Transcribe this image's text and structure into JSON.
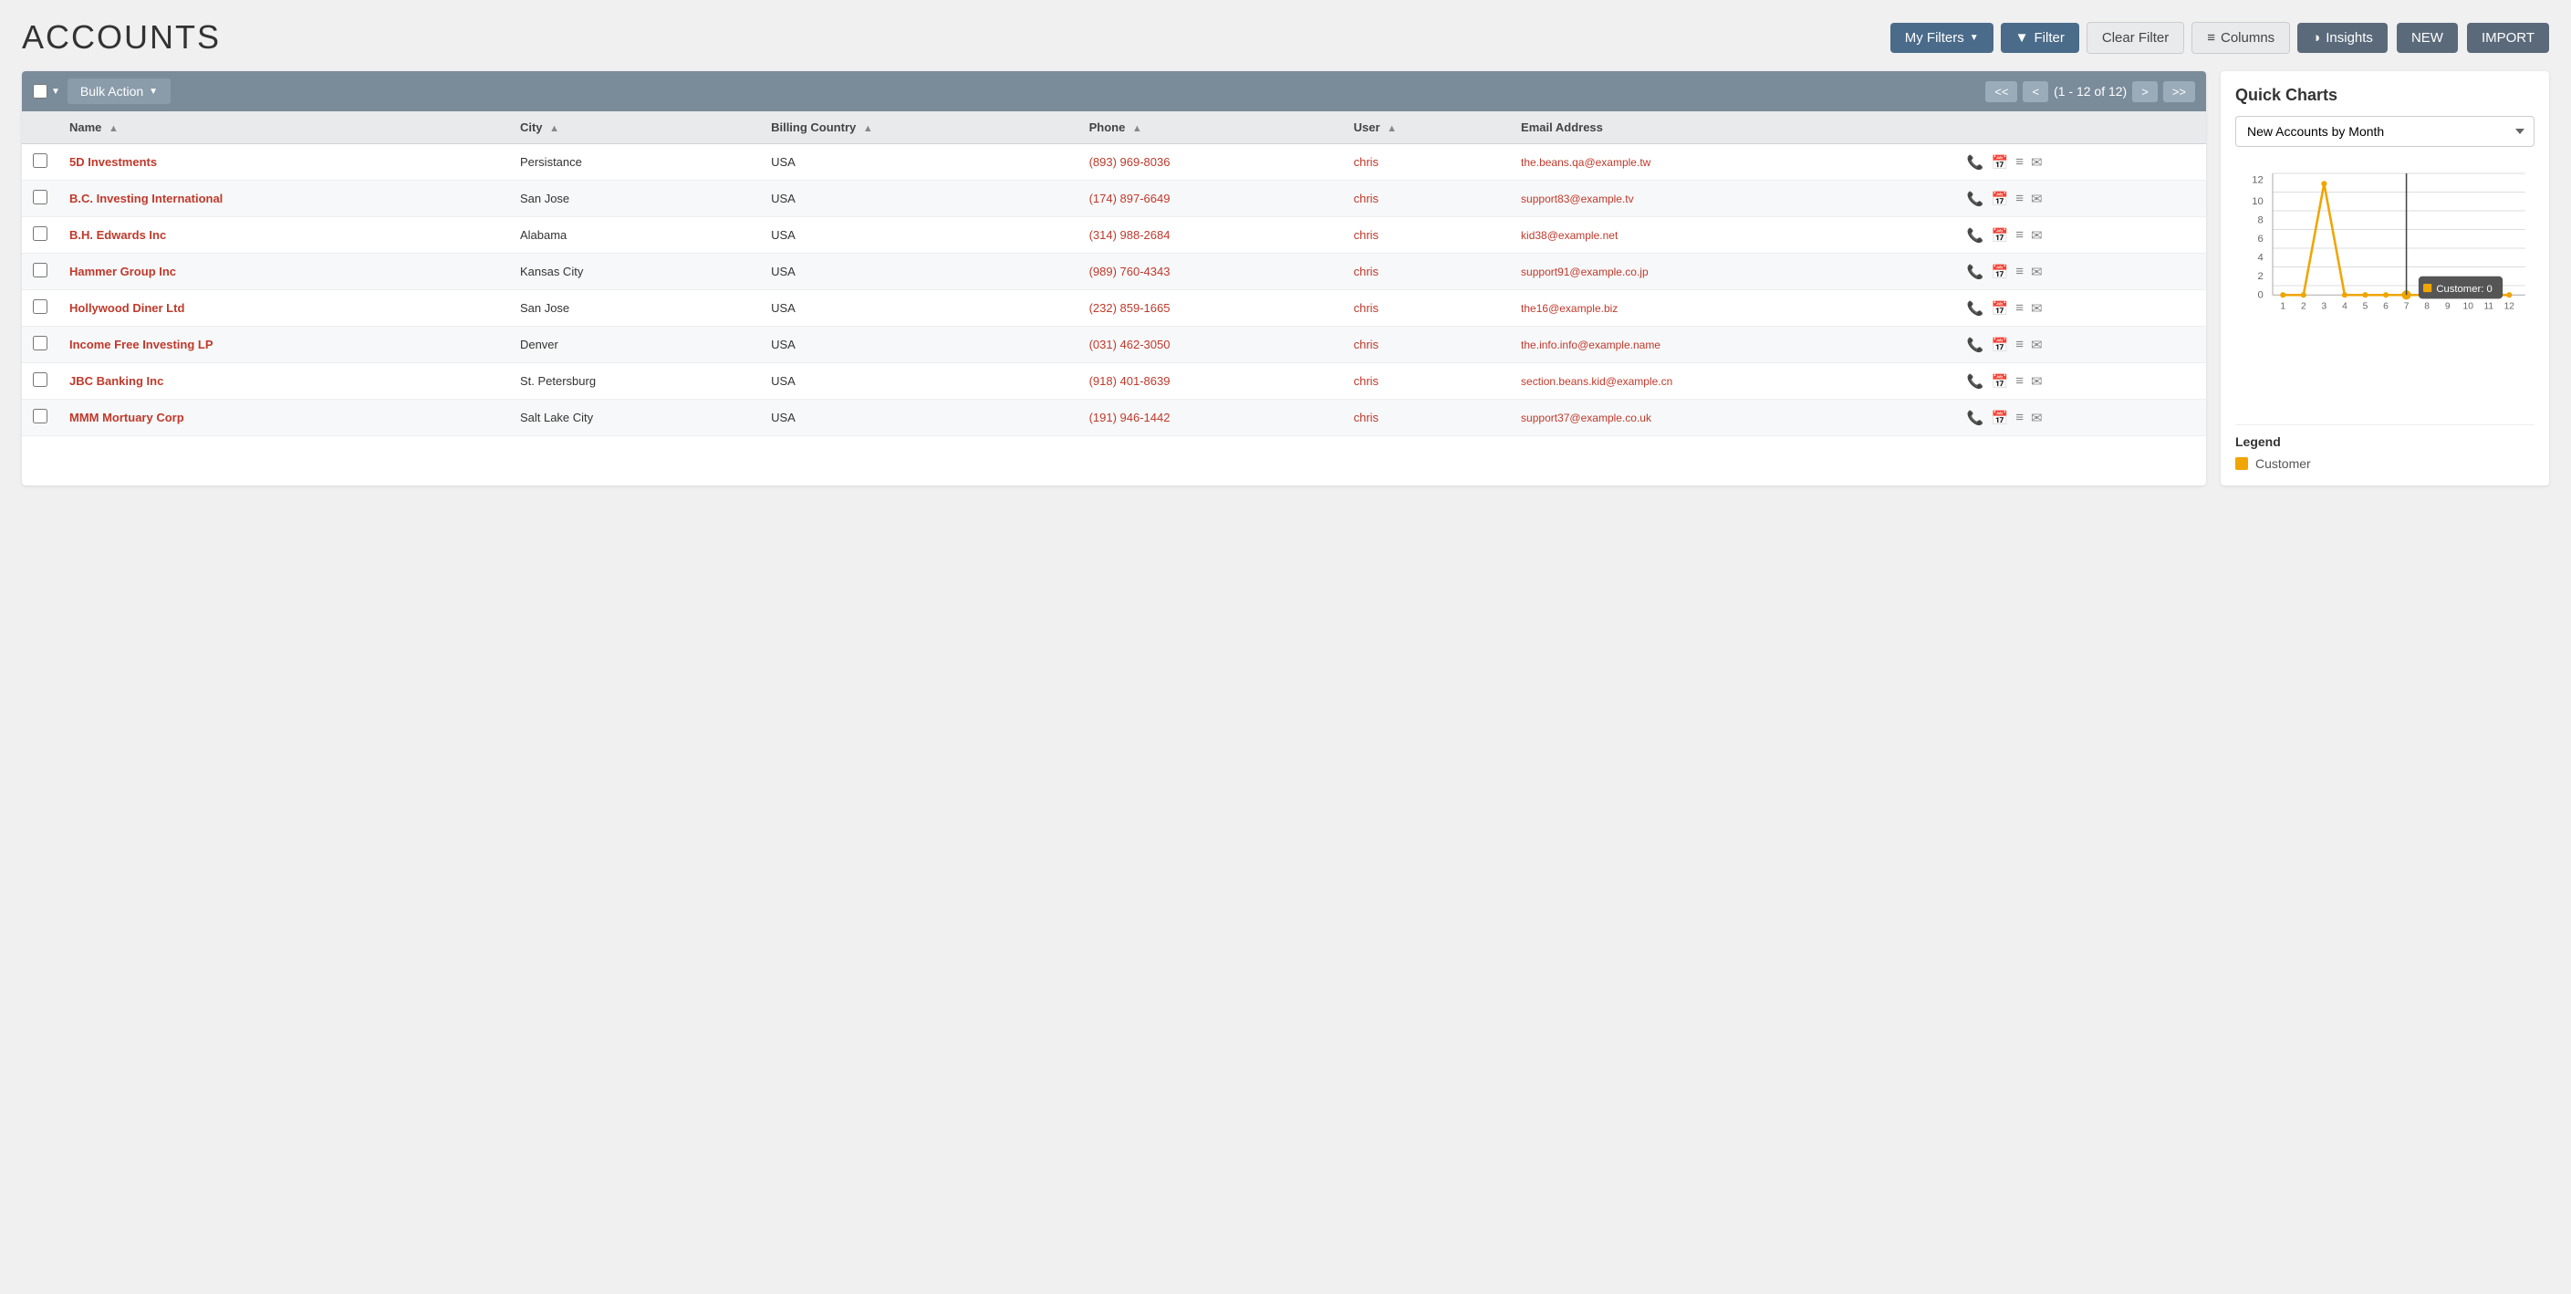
{
  "page": {
    "title": "ACCOUNTS"
  },
  "topActions": {
    "newLabel": "NEW",
    "importLabel": "IMPORT"
  },
  "filterBar": {
    "myFiltersLabel": "My Filters",
    "filterLabel": "Filter",
    "clearFilterLabel": "Clear Filter",
    "columnsLabel": "Columns",
    "insightsLabel": "Insights"
  },
  "toolbar": {
    "bulkActionLabel": "Bulk Action",
    "paginationText": "(1 - 12 of 12)"
  },
  "table": {
    "columns": [
      {
        "key": "name",
        "label": "Name",
        "sortable": true
      },
      {
        "key": "city",
        "label": "City",
        "sortable": true
      },
      {
        "key": "billingCountry",
        "label": "Billing Country",
        "sortable": true
      },
      {
        "key": "phone",
        "label": "Phone",
        "sortable": true
      },
      {
        "key": "user",
        "label": "User",
        "sortable": true
      },
      {
        "key": "email",
        "label": "Email Address",
        "sortable": false
      }
    ],
    "rows": [
      {
        "name": "5D Investments",
        "city": "Persistance",
        "billingCountry": "USA",
        "phone": "(893) 969-8036",
        "user": "chris",
        "email": "the.beans.qa@example.tw"
      },
      {
        "name": "B.C. Investing International",
        "city": "San Jose",
        "billingCountry": "USA",
        "phone": "(174) 897-6649",
        "user": "chris",
        "email": "support83@example.tv"
      },
      {
        "name": "B.H. Edwards Inc",
        "city": "Alabama",
        "billingCountry": "USA",
        "phone": "(314) 988-2684",
        "user": "chris",
        "email": "kid38@example.net"
      },
      {
        "name": "Hammer Group Inc",
        "city": "Kansas City",
        "billingCountry": "USA",
        "phone": "(989) 760-4343",
        "user": "chris",
        "email": "support91@example.co.jp"
      },
      {
        "name": "Hollywood Diner Ltd",
        "city": "San Jose",
        "billingCountry": "USA",
        "phone": "(232) 859-1665",
        "user": "chris",
        "email": "the16@example.biz"
      },
      {
        "name": "Income Free Investing LP",
        "city": "Denver",
        "billingCountry": "USA",
        "phone": "(031) 462-3050",
        "user": "chris",
        "email": "the.info.info@example.name"
      },
      {
        "name": "JBC Banking Inc",
        "city": "St. Petersburg",
        "billingCountry": "USA",
        "phone": "(918) 401-8639",
        "user": "chris",
        "email": "section.beans.kid@example.cn"
      },
      {
        "name": "MMM Mortuary Corp",
        "city": "Salt Lake City",
        "billingCountry": "USA",
        "phone": "(191) 946-1442",
        "user": "chris",
        "email": "support37@example.co.uk"
      }
    ]
  },
  "chart": {
    "panelTitle": "Quick Charts",
    "selectLabel": "New Accounts by Month",
    "legendLabel": "Customer",
    "tooltipLabel": "Customer: 0",
    "xLabels": [
      "1",
      "2",
      "3",
      "4",
      "5",
      "6",
      "7",
      "8",
      "9",
      "10",
      "11",
      "12"
    ],
    "yLabels": [
      "0",
      "2",
      "4",
      "6",
      "8",
      "10",
      "12"
    ],
    "data": [
      0,
      0,
      11,
      0,
      0,
      0,
      0,
      0,
      0,
      0,
      0,
      0
    ],
    "tooltipX": 7,
    "tooltipY": 0
  }
}
